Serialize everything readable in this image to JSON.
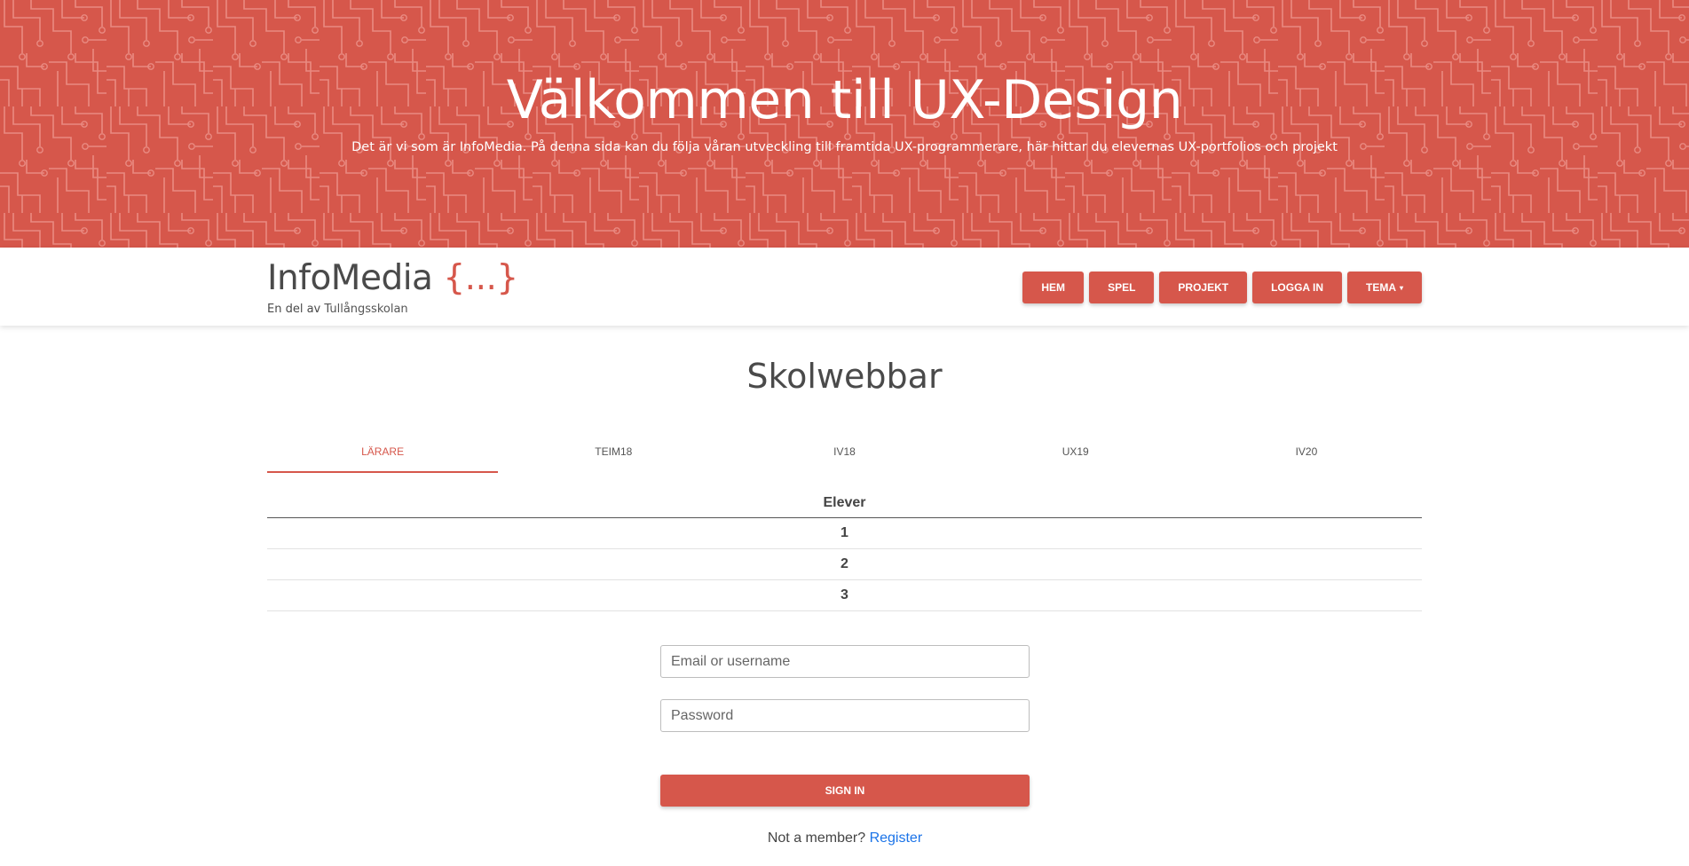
{
  "hero": {
    "title": "Välkommen till UX-Design",
    "subtitle": "Det är vi som är InfoMedia. På denna sida kan du följa våran utveckling till framtida UX-programmerare, här hittar du elevernas UX-portfolios och projekt"
  },
  "brand": {
    "name": "InfoMedia",
    "braces": "{...}",
    "tagline_prefix": "En del av",
    "school": "Tullångsskolan"
  },
  "nav": {
    "items": [
      {
        "label": "HEM"
      },
      {
        "label": "SPEL"
      },
      {
        "label": "PROJEKT"
      },
      {
        "label": "LOGGA IN"
      },
      {
        "label": "TEMA",
        "caret": "▾"
      }
    ]
  },
  "main": {
    "title": "Skolwebbar",
    "tabs": [
      {
        "label": "LÄRARE",
        "active": true
      },
      {
        "label": "TEIM18"
      },
      {
        "label": "IV18"
      },
      {
        "label": "UX19"
      },
      {
        "label": "IV20"
      }
    ],
    "table": {
      "header": "Elever",
      "rows": [
        "1",
        "2",
        "3"
      ]
    }
  },
  "login": {
    "email_placeholder": "Email or username",
    "password_placeholder": "Password",
    "signin_label": "SIGN IN",
    "not_member": "Not a member?",
    "register_label": "Register"
  },
  "colors": {
    "accent": "#d6574b",
    "link": "#1a73e8"
  }
}
